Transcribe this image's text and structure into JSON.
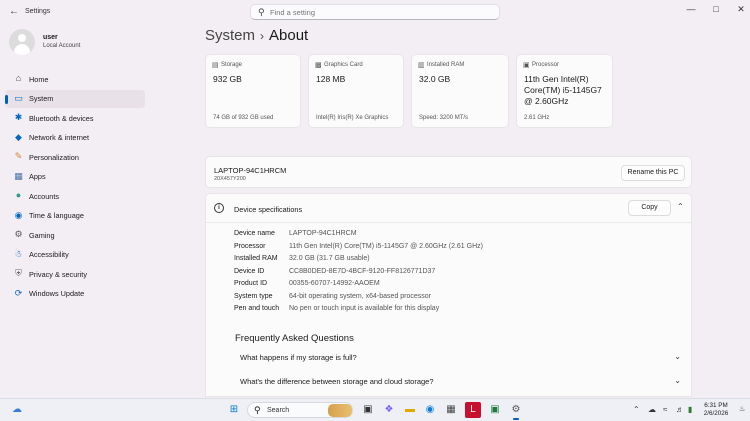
{
  "window": {
    "app_title": "Settings",
    "search_placeholder": "Find a setting"
  },
  "user": {
    "name": "user",
    "account_type": "Local Account"
  },
  "sidebar": {
    "items": [
      {
        "label": "Home",
        "icon": "home-icon"
      },
      {
        "label": "System",
        "icon": "system-icon",
        "active": true
      },
      {
        "label": "Bluetooth & devices",
        "icon": "bluetooth-icon"
      },
      {
        "label": "Network & internet",
        "icon": "network-icon"
      },
      {
        "label": "Personalization",
        "icon": "brush-icon"
      },
      {
        "label": "Apps",
        "icon": "apps-icon"
      },
      {
        "label": "Accounts",
        "icon": "accounts-icon"
      },
      {
        "label": "Time & language",
        "icon": "globe-icon"
      },
      {
        "label": "Gaming",
        "icon": "gaming-icon"
      },
      {
        "label": "Accessibility",
        "icon": "accessibility-icon"
      },
      {
        "label": "Privacy & security",
        "icon": "shield-icon"
      },
      {
        "label": "Windows Update",
        "icon": "update-icon"
      }
    ]
  },
  "breadcrumb": {
    "parent": "System",
    "current": "About"
  },
  "cards": [
    {
      "label": "Storage",
      "value": "932 GB",
      "sub": "74 GB of 932 GB used",
      "icon": "storage-icon"
    },
    {
      "label": "Graphics Card",
      "value": "128 MB",
      "sub": "Intel(R) Iris(R) Xe Graphics",
      "icon": "gpu-icon"
    },
    {
      "label": "Installed RAM",
      "value": "32.0 GB",
      "sub": "Speed: 3200 MT/s",
      "icon": "ram-icon"
    },
    {
      "label": "Processor",
      "value": "11th Gen Intel(R) Core(TM) i5-1145G7 @ 2.60GHz",
      "sub": "2.61 GHz",
      "icon": "cpu-icon"
    }
  ],
  "pc": {
    "name": "LAPTOP-94C1HRCM",
    "model": "20X457Y200",
    "rename_label": "Rename this PC"
  },
  "specs": {
    "title": "Device specifications",
    "copy_label": "Copy",
    "rows": [
      {
        "key": "Device name",
        "value": "LAPTOP-94C1HRCM"
      },
      {
        "key": "Processor",
        "value": "11th Gen Intel(R) Core(TM) i5-1145G7 @ 2.60GHz (2.61 GHz)"
      },
      {
        "key": "Installed RAM",
        "value": "32.0 GB (31.7 GB usable)"
      },
      {
        "key": "Device ID",
        "value": "CC8B0DED-8E7D-4BCF-9120-FF8126771D37"
      },
      {
        "key": "Product ID",
        "value": "00355-60707-14992-AAOEM"
      },
      {
        "key": "System type",
        "value": "64-bit operating system, x64-based processor"
      },
      {
        "key": "Pen and touch",
        "value": "No pen or touch input is available for this display"
      }
    ]
  },
  "faq": {
    "title": "Frequently Asked Questions",
    "items": [
      {
        "question": "What happens if my storage is full?"
      },
      {
        "question": "What's the difference between storage and cloud storage?"
      }
    ]
  },
  "taskbar": {
    "search_label": "Search",
    "time": "6:31 PM",
    "date": "2/6/2026"
  },
  "colors": {
    "accent": "#005fb8",
    "background": "#f3eef3",
    "card": "#fbfbfb"
  }
}
